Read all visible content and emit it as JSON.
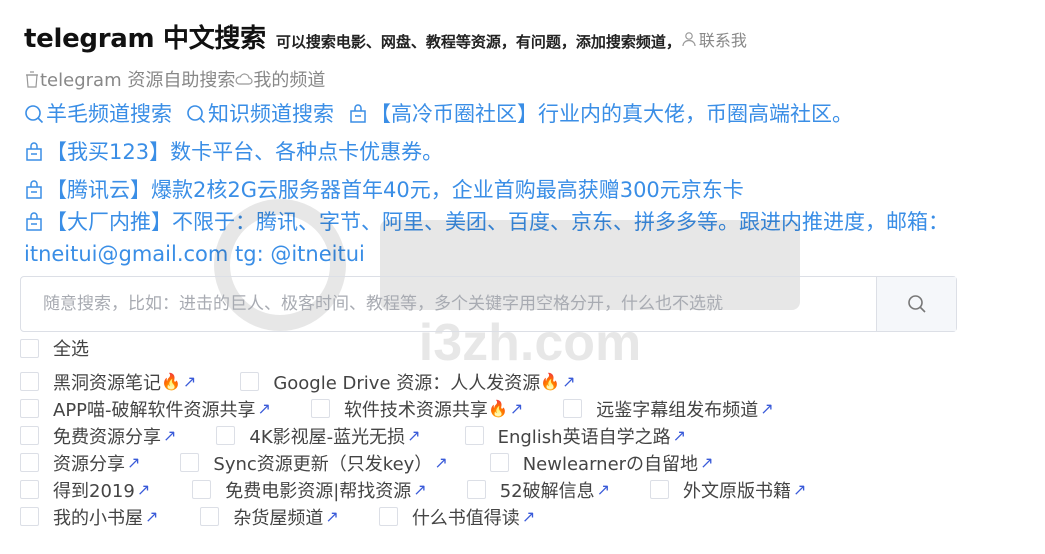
{
  "header": {
    "title": "telegram 中文搜索",
    "subtitle": "可以搜索电影、网盘、教程等资源，有问题，添加搜索频道，",
    "contact": "联系我"
  },
  "subnav": {
    "selfhelp": "telegram 资源自助搜索",
    "mychannel": "我的频道"
  },
  "links": {
    "wool": "羊毛频道搜索",
    "knowledge": "知识频道搜索",
    "crypto": "【高冷币圈社区】行业内的真大佬，币圈高端社区。",
    "card": "【我买123】数卡平台、各种点卡优惠券。",
    "cloud": "【腾讯云】爆款2核2G云服务器首年40元，企业首购最高获赠300元京东卡",
    "referral": "【大厂内推】不限于：腾讯、字节、阿里、美团、百度、京东、拼多多等。跟进内推进度，邮箱：itneitui@gmail.com tg: @itneitui"
  },
  "search": {
    "placeholder": "随意搜索，比如：进击的巨人、极客时间、教程等，多个关键字用空格分开，什么也不选就",
    "icon": "search-icon"
  },
  "select_all": "全选",
  "channels": [
    [
      {
        "label": "黑洞资源笔记",
        "fire": true
      },
      {
        "label": "Google Drive 资源：人人发资源",
        "fire": true
      }
    ],
    [
      {
        "label": "APP喵-破解软件资源共享",
        "fire": false
      },
      {
        "label": "软件技术资源共享",
        "fire": true
      },
      {
        "label": "远鉴字幕组发布频道",
        "fire": false
      }
    ],
    [
      {
        "label": "免费资源分享",
        "fire": false
      },
      {
        "label": "4K影视屋-蓝光无损",
        "fire": false
      },
      {
        "label": "English英语自学之路",
        "fire": false
      }
    ],
    [
      {
        "label": "资源分享",
        "fire": false
      },
      {
        "label": "Sync资源更新（只发key）",
        "fire": false
      },
      {
        "label": "Newlearnerの自留地",
        "fire": false
      }
    ],
    [
      {
        "label": "得到2019",
        "fire": false
      },
      {
        "label": "免费电影资源|帮找资源",
        "fire": false
      },
      {
        "label": "52破解信息",
        "fire": false
      },
      {
        "label": "外文原版书籍",
        "fire": false
      }
    ],
    [
      {
        "label": "我的小书屋",
        "fire": false
      },
      {
        "label": "杂货屋频道",
        "fire": false
      },
      {
        "label": "什么书值得读",
        "fire": false
      }
    ]
  ],
  "symbols": {
    "fire": "🔥",
    "arrow": "↗"
  },
  "watermark": "i3zh.com",
  "colors": {
    "link": "#3a8ee6",
    "arrow": "#3a5bd9",
    "border": "#dcdfe6"
  }
}
